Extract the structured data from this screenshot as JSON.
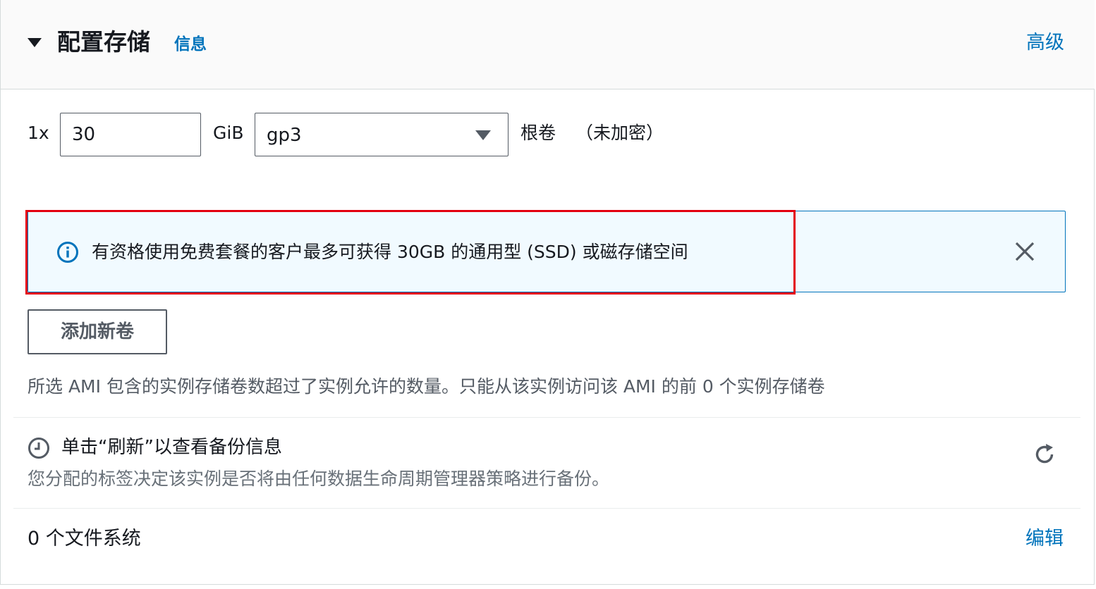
{
  "section": {
    "title": "配置存储",
    "info_link": "信息",
    "advanced_link": "高级"
  },
  "volume": {
    "multiplier": "1x",
    "size_value": "30",
    "size_unit": "GiB",
    "volume_type": "gp3",
    "root_label": "根卷",
    "encryption_label": "（未加密）"
  },
  "alert": {
    "message": "有资格使用免费套餐的客户最多可获得 30GB 的通用型 (SSD) 或磁存储空间",
    "icon": "info-icon",
    "close_icon": "close-icon"
  },
  "actions": {
    "add_volume_label": "添加新卷"
  },
  "ami_note": "所选 AMI 包含的实例存储卷数超过了实例允许的数量。只能从该实例访问该 AMI 的前 0 个实例存储卷",
  "backup": {
    "title": "单击“刷新”以查看备份信息",
    "description": "您分配的标签决定该实例是否将由任何数据生命周期管理器策略进行备份。",
    "icon": "clock-icon",
    "refresh_icon": "refresh-icon"
  },
  "file_systems": {
    "count_label": "0 个文件系统",
    "edit_link": "编辑"
  },
  "colors": {
    "link": "#0073bb",
    "alert_bg": "#f1faff",
    "highlight": "#e3000f",
    "header_bg": "#fafafa"
  }
}
